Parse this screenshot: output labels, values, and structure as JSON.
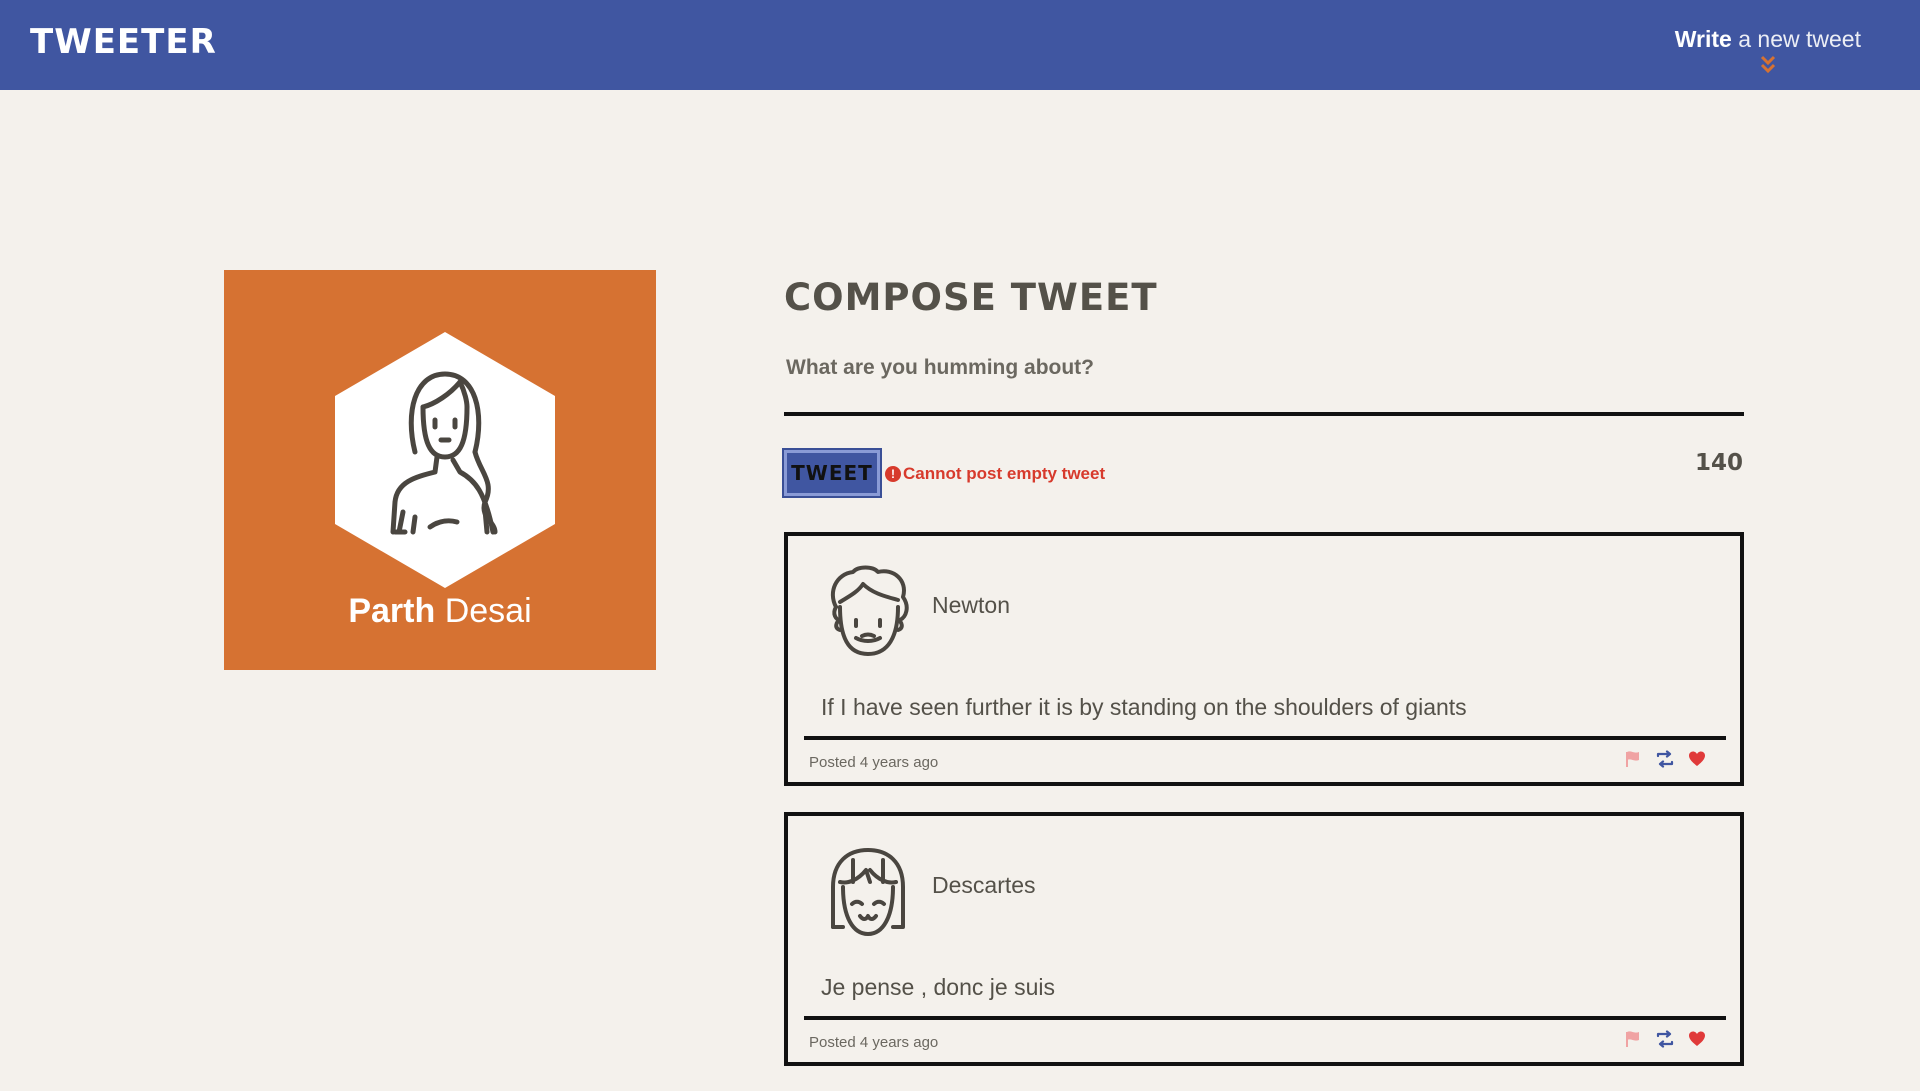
{
  "nav": {
    "brand": "TWEETER",
    "write_bold": "Write",
    "write_rest": "a new tweet",
    "chevron_icon": "double-chevron-down-icon",
    "color_bg": "#4056a1",
    "color_accent": "#d67232"
  },
  "profile": {
    "first_name": "Parth",
    "last_name": "Desai",
    "avatar_icon": "woman-avatar-icon",
    "color_bg": "#d67232"
  },
  "compose": {
    "title": "COMPOSE TWEET",
    "placeholder": "What are you humming about?",
    "button_label": "TWEET",
    "error_text": "Cannot post empty tweet",
    "error_icon": "exclamation-circle-icon",
    "counter": "140"
  },
  "tweets": [
    {
      "author": "Newton",
      "avatar_icon": "curly-hair-avatar-icon",
      "content": "If I have seen further it is by standing on the shoulders of giants",
      "posted": "Posted 4 years ago",
      "actions": [
        "flag-icon",
        "retweet-icon",
        "heart-icon"
      ]
    },
    {
      "author": "Descartes",
      "avatar_icon": "bob-hair-avatar-icon",
      "content": "Je pense , donc je suis",
      "posted": "Posted 4 years ago",
      "actions": [
        "flag-icon",
        "retweet-icon",
        "heart-icon"
      ]
    }
  ]
}
